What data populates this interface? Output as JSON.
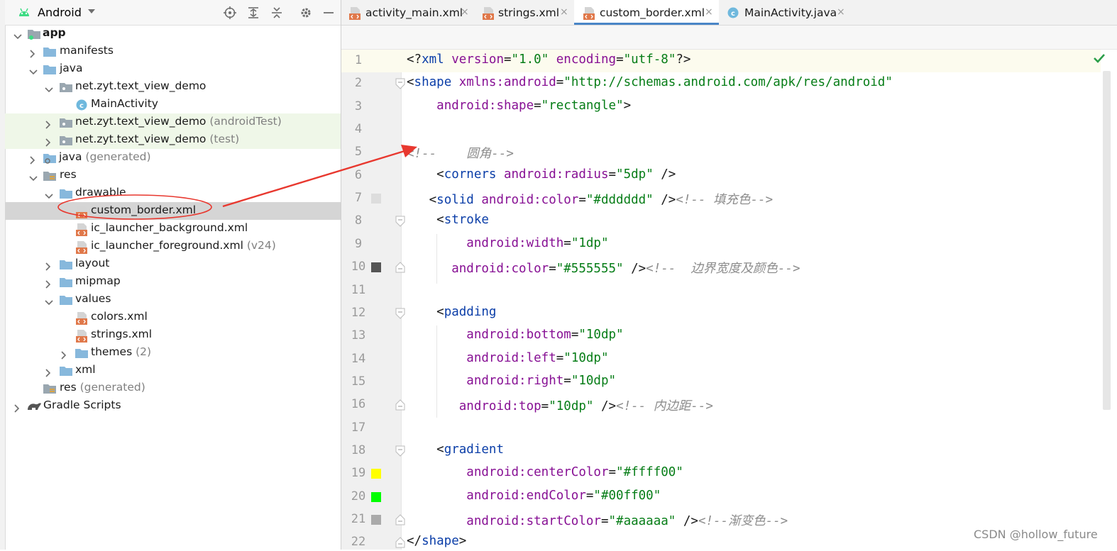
{
  "project_panel": {
    "title": "Android",
    "toolbar_icons": [
      "locate-icon",
      "expand-all-icon",
      "collapse-all-icon",
      "gear-icon",
      "minimize-icon"
    ],
    "tree": [
      {
        "label": "app",
        "suffix": "",
        "icon": "module-folder-icon"
      },
      {
        "label": "manifests",
        "suffix": "",
        "icon": "folder-icon"
      },
      {
        "label": "java",
        "suffix": "",
        "icon": "folder-icon"
      },
      {
        "label": "net.zyt.text_view_demo",
        "suffix": "",
        "icon": "package-icon"
      },
      {
        "label": "MainActivity",
        "suffix": "",
        "icon": "class-icon"
      },
      {
        "label": "net.zyt.text_view_demo",
        "suffix": " (androidTest)",
        "icon": "package-icon"
      },
      {
        "label": "net.zyt.text_view_demo",
        "suffix": " (test)",
        "icon": "package-icon"
      },
      {
        "label": "java",
        "suffix": " (generated)",
        "icon": "generated-folder-icon"
      },
      {
        "label": "res",
        "suffix": "",
        "icon": "res-folder-icon"
      },
      {
        "label": "drawable",
        "suffix": "",
        "icon": "folder-icon"
      },
      {
        "label": "custom_border.xml",
        "suffix": "",
        "icon": "xml-file-icon"
      },
      {
        "label": "ic_launcher_background.xml",
        "suffix": "",
        "icon": "xml-file-icon"
      },
      {
        "label": "ic_launcher_foreground.xml",
        "suffix": " (v24)",
        "icon": "xml-file-icon"
      },
      {
        "label": "layout",
        "suffix": "",
        "icon": "folder-icon"
      },
      {
        "label": "mipmap",
        "suffix": "",
        "icon": "folder-icon"
      },
      {
        "label": "values",
        "suffix": "",
        "icon": "folder-icon"
      },
      {
        "label": "colors.xml",
        "suffix": "",
        "icon": "xml-file-icon"
      },
      {
        "label": "strings.xml",
        "suffix": "",
        "icon": "xml-file-icon"
      },
      {
        "label": "themes",
        "suffix": " (2)",
        "icon": "folder-icon"
      },
      {
        "label": "xml",
        "suffix": "",
        "icon": "folder-icon"
      },
      {
        "label": "res",
        "suffix": " (generated)",
        "icon": "res-folder-icon"
      },
      {
        "label": "Gradle Scripts",
        "suffix": "",
        "icon": "gradle-icon"
      }
    ]
  },
  "tabs": [
    {
      "label": "activity_main.xml",
      "icon": "xml-file-icon",
      "active": false
    },
    {
      "label": "strings.xml",
      "icon": "xml-file-icon",
      "active": false
    },
    {
      "label": "custom_border.xml",
      "icon": "xml-file-icon",
      "active": true
    },
    {
      "label": "MainActivity.java",
      "icon": "class-icon",
      "active": false
    }
  ],
  "tab_close_glyph": "×",
  "editor": {
    "lines": [
      {
        "n": "1",
        "tokens": [
          [
            "pi",
            "<?"
          ],
          [
            "tag",
            "xml "
          ],
          [
            "attr",
            "version"
          ],
          [
            "pi",
            "="
          ],
          [
            "val",
            "\"1.0\" "
          ],
          [
            "attr",
            "encoding"
          ],
          [
            "pi",
            "="
          ],
          [
            "val",
            "\"utf-8\""
          ],
          [
            "pi",
            "?>"
          ]
        ]
      },
      {
        "n": "2",
        "tokens": [
          [
            "pi",
            "<"
          ],
          [
            "tag",
            "shape "
          ],
          [
            "attr",
            "xmlns:android"
          ],
          [
            "pi",
            "="
          ],
          [
            "val",
            "\"http://schemas.android.com/apk/res/android\""
          ]
        ]
      },
      {
        "n": "3",
        "tokens": [
          [
            "pi",
            "    "
          ],
          [
            "attr",
            "android:shape"
          ],
          [
            "pi",
            "="
          ],
          [
            "val",
            "\"rectangle\""
          ],
          [
            "pi",
            ">"
          ]
        ]
      },
      {
        "n": "4",
        "tokens": []
      },
      {
        "n": "5",
        "tokens": [
          [
            "cmt",
            "<!--    圆角-->"
          ]
        ]
      },
      {
        "n": "6",
        "tokens": [
          [
            "pi",
            "    <"
          ],
          [
            "tag",
            "corners "
          ],
          [
            "attr",
            "android:radius"
          ],
          [
            "pi",
            "="
          ],
          [
            "val",
            "\"5dp\" "
          ],
          [
            "pi",
            "/>"
          ]
        ]
      },
      {
        "n": "7",
        "tokens": [
          [
            "pi",
            "   <"
          ],
          [
            "tag",
            "solid "
          ],
          [
            "attr",
            "android:color"
          ],
          [
            "pi",
            "="
          ],
          [
            "val",
            "\"#dddddd\" "
          ],
          [
            "pi",
            "/>"
          ],
          [
            "cmt",
            "<!-- 填充色-->"
          ]
        ]
      },
      {
        "n": "8",
        "tokens": [
          [
            "pi",
            "    <"
          ],
          [
            "tag",
            "stroke"
          ]
        ]
      },
      {
        "n": "9",
        "tokens": [
          [
            "pi",
            "        "
          ],
          [
            "attr",
            "android:width"
          ],
          [
            "pi",
            "="
          ],
          [
            "val",
            "\"1dp\""
          ]
        ]
      },
      {
        "n": "10",
        "tokens": [
          [
            "pi",
            "      "
          ],
          [
            "attr",
            "android:color"
          ],
          [
            "pi",
            "="
          ],
          [
            "val",
            "\"#555555\" "
          ],
          [
            "pi",
            "/>"
          ],
          [
            "cmt",
            "<!--  边界宽度及颜色-->"
          ]
        ]
      },
      {
        "n": "11",
        "tokens": []
      },
      {
        "n": "12",
        "tokens": [
          [
            "pi",
            "    <"
          ],
          [
            "tag",
            "padding"
          ]
        ]
      },
      {
        "n": "13",
        "tokens": [
          [
            "pi",
            "        "
          ],
          [
            "attr",
            "android:bottom"
          ],
          [
            "pi",
            "="
          ],
          [
            "val",
            "\"10dp\""
          ]
        ]
      },
      {
        "n": "14",
        "tokens": [
          [
            "pi",
            "        "
          ],
          [
            "attr",
            "android:left"
          ],
          [
            "pi",
            "="
          ],
          [
            "val",
            "\"10dp\""
          ]
        ]
      },
      {
        "n": "15",
        "tokens": [
          [
            "pi",
            "        "
          ],
          [
            "attr",
            "android:right"
          ],
          [
            "pi",
            "="
          ],
          [
            "val",
            "\"10dp\""
          ]
        ]
      },
      {
        "n": "16",
        "tokens": [
          [
            "pi",
            "       "
          ],
          [
            "attr",
            "android:top"
          ],
          [
            "pi",
            "="
          ],
          [
            "val",
            "\"10dp\" "
          ],
          [
            "pi",
            "/>"
          ],
          [
            "cmt",
            "<!-- 内边距-->"
          ]
        ]
      },
      {
        "n": "17",
        "tokens": []
      },
      {
        "n": "18",
        "tokens": [
          [
            "pi",
            "    <"
          ],
          [
            "tag",
            "gradient"
          ]
        ]
      },
      {
        "n": "19",
        "tokens": [
          [
            "pi",
            "        "
          ],
          [
            "attr",
            "android:centerColor"
          ],
          [
            "pi",
            "="
          ],
          [
            "val",
            "\"#ffff00\""
          ]
        ]
      },
      {
        "n": "20",
        "tokens": [
          [
            "pi",
            "        "
          ],
          [
            "attr",
            "android:endColor"
          ],
          [
            "pi",
            "="
          ],
          [
            "val",
            "\"#00ff00\""
          ]
        ]
      },
      {
        "n": "21",
        "tokens": [
          [
            "pi",
            "        "
          ],
          [
            "attr",
            "android:startColor"
          ],
          [
            "pi",
            "="
          ],
          [
            "val",
            "\"#aaaaaa\" "
          ],
          [
            "pi",
            "/>"
          ],
          [
            "cmt",
            "<!--渐变色-->"
          ]
        ]
      },
      {
        "n": "22",
        "tokens": [
          [
            "pi",
            "</"
          ],
          [
            "tag",
            "shape"
          ],
          [
            "pi",
            ">"
          ]
        ]
      }
    ],
    "swatches": [
      {
        "line": "7",
        "color": "#dddddd"
      },
      {
        "line": "10",
        "color": "#555555"
      },
      {
        "line": "19",
        "color": "#ffff00"
      },
      {
        "line": "20",
        "color": "#00ff00"
      },
      {
        "line": "21",
        "color": "#aaaaaa"
      }
    ]
  },
  "watermark": "CSDN @hollow_future",
  "colors": {
    "accent": "#4a86c7",
    "annotation": "#e8382f",
    "selection": "#d5d5d5",
    "test_highlight": "#eff7e8"
  }
}
